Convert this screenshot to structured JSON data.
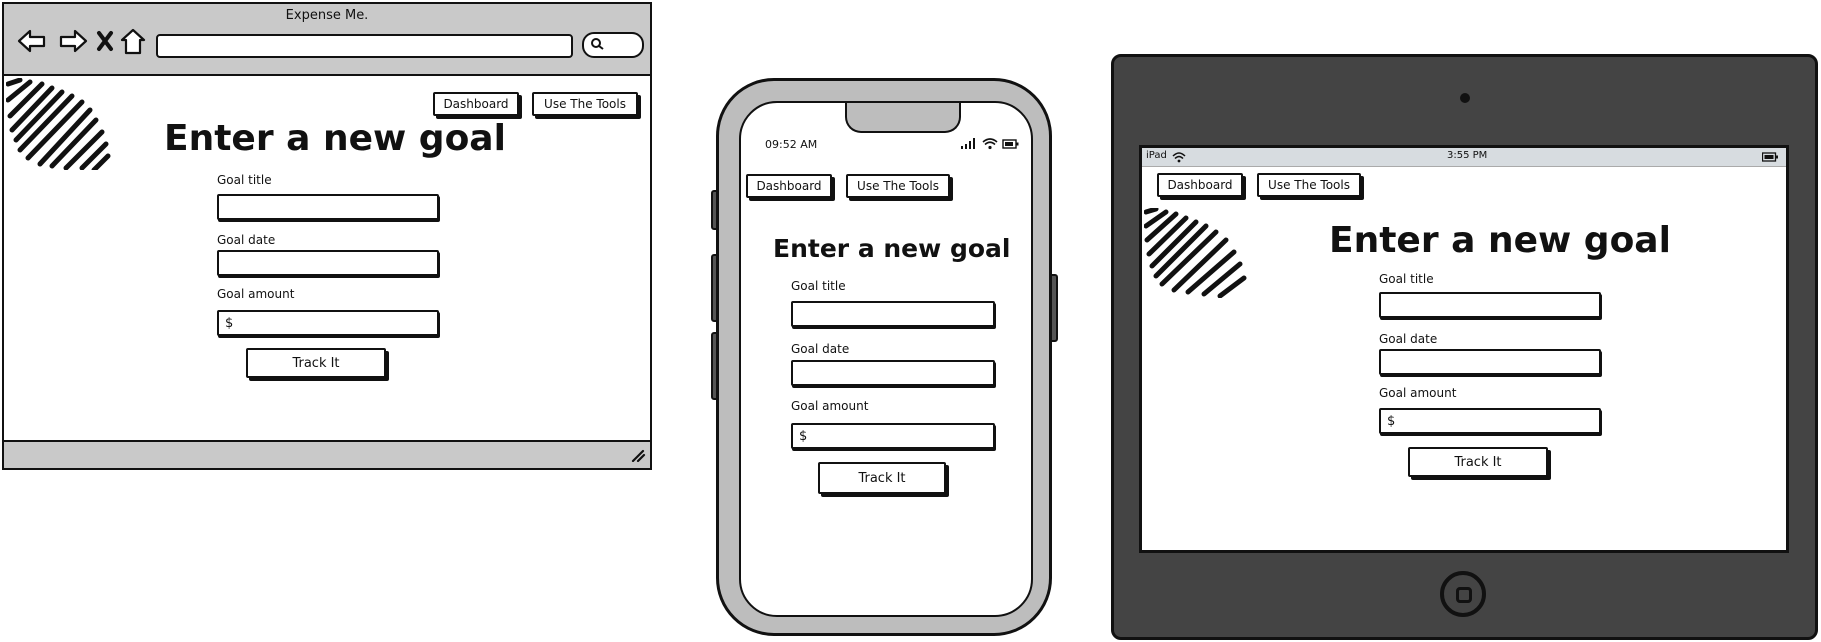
{
  "browser": {
    "window_title": "Expense Me.",
    "nav": {
      "dashboard_label": "Dashboard",
      "tools_label": "Use The Tools"
    },
    "heading": "Enter a new goal",
    "form": {
      "title_label": "Goal title",
      "date_label": "Goal date",
      "amount_label": "Goal amount",
      "amount_prefix": "$",
      "submit_label": "Track It"
    }
  },
  "phone": {
    "status": {
      "time": "09:52 AM"
    },
    "nav": {
      "dashboard_label": "Dashboard",
      "tools_label": "Use The Tools"
    },
    "heading": "Enter a new goal",
    "form": {
      "title_label": "Goal title",
      "date_label": "Goal date",
      "amount_label": "Goal amount",
      "amount_prefix": "$",
      "submit_label": "Track It"
    }
  },
  "tablet": {
    "status": {
      "device": "iPad",
      "time": "3:55 PM"
    },
    "nav": {
      "dashboard_label": "Dashboard",
      "tools_label": "Use The Tools"
    },
    "heading": "Enter a new goal",
    "form": {
      "title_label": "Goal title",
      "date_label": "Goal date",
      "amount_label": "Goal amount",
      "amount_prefix": "$",
      "submit_label": "Track It"
    }
  },
  "icons": {
    "back": "back-arrow-icon",
    "forward": "forward-arrow-icon",
    "close": "close-icon",
    "home": "home-icon",
    "search": "search-icon",
    "logo": "scribble-logo-icon",
    "signal": "signal-icon",
    "wifi": "wifi-icon",
    "battery": "battery-icon",
    "resize": "resize-grip-icon"
  },
  "colors": {
    "ink": "#111111",
    "chrome_gray": "#c9c9c9",
    "phone_frame": "#bdbdbd",
    "tablet_frame": "#444444",
    "tablet_statusbar": "#d7dce0"
  }
}
